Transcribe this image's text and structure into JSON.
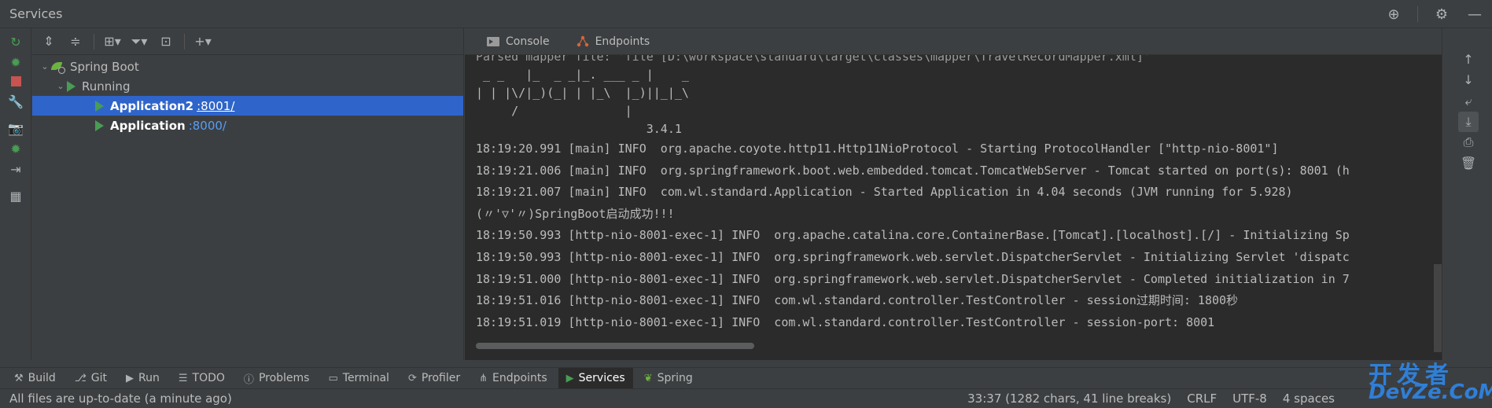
{
  "window": {
    "title": "Services"
  },
  "tree": {
    "root": "Spring Boot",
    "group": "Running",
    "apps": [
      {
        "name": "Application2",
        "port": ":8001/"
      },
      {
        "name": "Application",
        "port": ":8000/"
      }
    ]
  },
  "console": {
    "tabs": [
      "Console",
      "Endpoints"
    ],
    "cut_line": "Parsed mapper file: 'file [D:\\workspace\\standard\\target\\classes\\mapper\\TravelRecordMapper.xml]'",
    "banner": [
      " _ _   |_  _ _|_. ___ _ |    _ ",
      "| | |\\/|_)(_| | |_\\  |_)||_|_\\ ",
      "     /               |         ",
      "                        3.4.1 "
    ],
    "lines": [
      "18:19:20.991 [main] INFO  org.apache.coyote.http11.Http11NioProtocol - Starting ProtocolHandler [\"http-nio-8001\"]",
      "18:19:21.006 [main] INFO  org.springframework.boot.web.embedded.tomcat.TomcatWebServer - Tomcat started on port(s): 8001 (h",
      "18:19:21.007 [main] INFO  com.wl.standard.Application - Started Application in 4.04 seconds (JVM running for 5.928)",
      "(〃'▽'〃)SpringBoot启动成功!!!",
      "18:19:50.993 [http-nio-8001-exec-1] INFO  org.apache.catalina.core.ContainerBase.[Tomcat].[localhost].[/] - Initializing Sp",
      "18:19:50.993 [http-nio-8001-exec-1] INFO  org.springframework.web.servlet.DispatcherServlet - Initializing Servlet 'dispatc",
      "18:19:51.000 [http-nio-8001-exec-1] INFO  org.springframework.web.servlet.DispatcherServlet - Completed initialization in 7",
      "18:19:51.016 [http-nio-8001-exec-1] INFO  com.wl.standard.controller.TestController - session过期时间: 1800秒",
      "18:19:51.019 [http-nio-8001-exec-1] INFO  com.wl.standard.controller.TestController - session-port: 8001"
    ]
  },
  "bottom_tabs": [
    {
      "label": "Build",
      "icon": "hammer-icon"
    },
    {
      "label": "Git",
      "icon": "branch-icon"
    },
    {
      "label": "Run",
      "icon": "play-icon"
    },
    {
      "label": "TODO",
      "icon": "list-icon"
    },
    {
      "label": "Problems",
      "icon": "info-icon"
    },
    {
      "label": "Terminal",
      "icon": "terminal-icon"
    },
    {
      "label": "Profiler",
      "icon": "profiler-icon"
    },
    {
      "label": "Endpoints",
      "icon": "endpoints-icon"
    },
    {
      "label": "Services",
      "icon": "services-icon",
      "active": true
    },
    {
      "label": "Spring",
      "icon": "spring-leaf-icon"
    }
  ],
  "status": {
    "message": "All files are up-to-date (a minute ago)",
    "position": "33:37 (1282 chars, 41 line breaks)",
    "line_sep": "CRLF",
    "encoding": "UTF-8",
    "indent": "4 spaces"
  },
  "watermark": {
    "cn": "开发者",
    "en": "DevZe.CoM"
  },
  "colors": {
    "accent": "#2f65ca",
    "run_green": "#499c54",
    "link_blue": "#589df6",
    "stop_red": "#c75450",
    "bg_console": "#2b2b2b",
    "bg_panel": "#3c3f41"
  }
}
